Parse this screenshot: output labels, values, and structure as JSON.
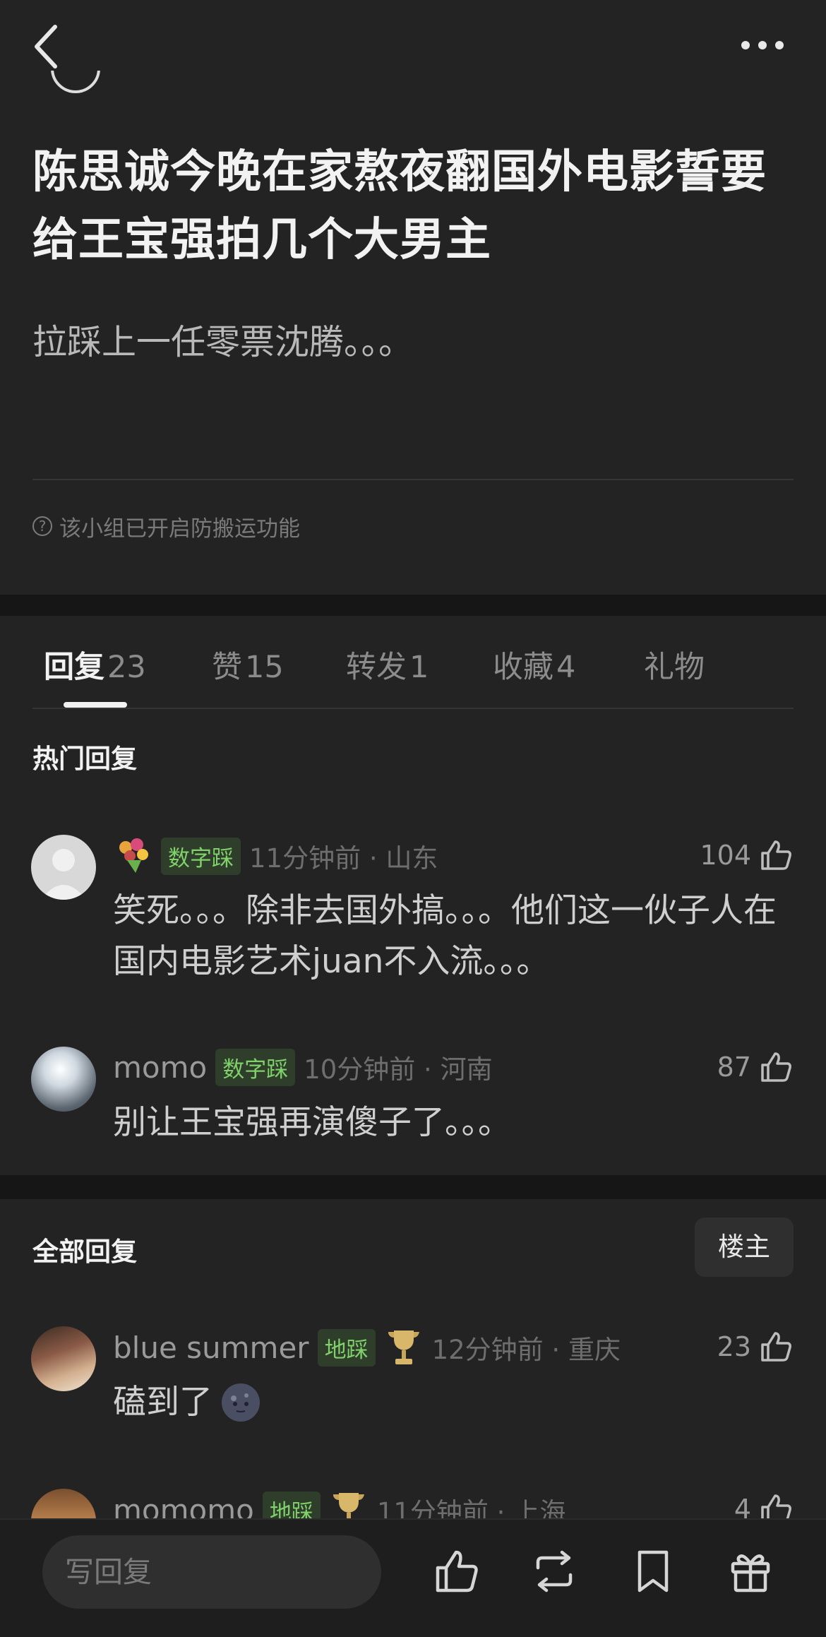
{
  "post": {
    "title": "陈思诚今晚在家熬夜翻国外电影誓要给王宝强拍几个大男主",
    "body": "拉踩上一任零票沈腾。。。",
    "notice": "该小组已开启防搬运功能"
  },
  "tabs": [
    {
      "label": "回复",
      "count": "23"
    },
    {
      "label": "赞",
      "count": "15"
    },
    {
      "label": "转发",
      "count": "1"
    },
    {
      "label": "收藏",
      "count": "4"
    },
    {
      "label": "礼物",
      "count": ""
    }
  ],
  "hot": {
    "title": "热门回复",
    "comments": [
      {
        "name": "",
        "badge": "数字踩",
        "time": "11分钟前 · 山东",
        "likes": "104",
        "text": "笑死。。。除非去国外搞。。。他们这一伙子人在国内电影艺术juan不入流。。。"
      },
      {
        "name": "momo",
        "badge": "数字踩",
        "time": "10分钟前 · 河南",
        "likes": "87",
        "text": "别让王宝强再演傻子了。。。"
      }
    ]
  },
  "all": {
    "title": "全部回复",
    "filter_label": "楼主",
    "comments": [
      {
        "name": "blue summer",
        "badge": "地踩",
        "time": "12分钟前 · 重庆",
        "likes": "23",
        "text": "磕到了"
      },
      {
        "name": "momomo",
        "badge": "地踩",
        "time": "11分钟前 · 上海",
        "likes": "4",
        "text": ""
      }
    ]
  },
  "bottom": {
    "reply_placeholder": "写回复"
  },
  "icons": {
    "back": "chevron-left-icon",
    "more": "more-dots-icon",
    "like": "thumb-up-icon",
    "repost": "repost-icon",
    "bookmark": "bookmark-icon",
    "gift": "gift-icon",
    "flower": "flower-bouquet-icon",
    "trophy": "trophy-icon",
    "moon": "new-moon-face-icon"
  }
}
